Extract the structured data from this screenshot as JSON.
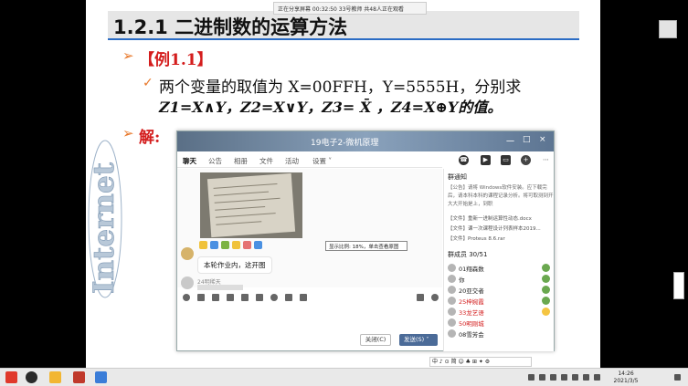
{
  "slide": {
    "title": "1.2.1  二进制数的运算方法",
    "status_banner": "正在分享屏幕  00:32:50   33号教师  共48人正在观看",
    "example_label": "【例1.1】",
    "line1": "两个变量的取值为 X=00FFH，Y=5555H，分别求",
    "line2": "Z1=X∧Y，Z2=X∨Y，Z3= X̄  ，Z4=X⊕Y的值。",
    "solve_label": "解:",
    "logo_text": "Internet"
  },
  "chat": {
    "title": "19电子2-微机原理",
    "header_buttons": [
      "一",
      "□",
      "×"
    ],
    "tabs": [
      "聊天",
      "公告",
      "相册",
      "文件",
      "活动",
      "设置 ˅"
    ],
    "right_icons": [
      "phone-icon",
      "video-icon",
      "screen-icon",
      "add-icon",
      "more-icon"
    ],
    "tooltip": "显示比例: 18%，单击查看原图",
    "messages": [
      {
        "name": "",
        "text": "本轮作业内，这开图"
      },
      {
        "name": "24明稀天",
        "text": ""
      }
    ],
    "close_button": "关闭(C)",
    "send_button": "发送(S) ˅",
    "sidebar": {
      "notice_title": "群通知",
      "notices": [
        "【公告】请将 Windows软件安装。应下载完",
        "后，请本科本科的课程记录分析。将可取测到开",
        "大大开始是上，到职"
      ],
      "files": [
        "【文件】重新一进制运算性动态.docx",
        "【文件】课一次课程设计列表样本2019...",
        "【文件】Proteus 8.6.rar"
      ],
      "members_title": "群成员 30/51",
      "members": [
        {
          "name": "01翔森数",
          "red": false
        },
        {
          "name": "你",
          "red": false
        },
        {
          "name": "20亚交者",
          "red": false
        },
        {
          "name": "25梓婉霞",
          "red": true
        },
        {
          "name": "33龙艺语",
          "red": true
        },
        {
          "name": "50明刚城",
          "red": true
        },
        {
          "name": "08雪芳会",
          "red": false
        }
      ]
    }
  },
  "ime": "中 ♪ ⊙ 简 ☺ ♣ ⊞ ✦ ⚙",
  "taskbar": {
    "clock_time": "14:26",
    "clock_date": "2021/3/5"
  },
  "colors": {
    "accent_orange": "#e8782a",
    "title_blue": "#2b6cc4",
    "red_text": "#d41d1d"
  }
}
